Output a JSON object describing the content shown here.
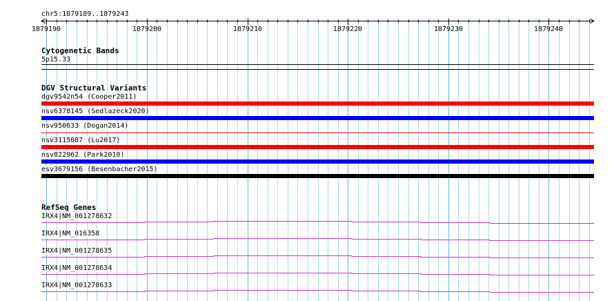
{
  "locus": "chr5:1879189..1879243",
  "ruler": {
    "start": 1879189.5,
    "end": 1879244.5,
    "ticks": [
      {
        "pos": 1879190,
        "label": "1879190"
      },
      {
        "pos": 1879200,
        "label": "1879200"
      },
      {
        "pos": 1879210,
        "label": "1879210"
      },
      {
        "pos": 1879220,
        "label": "1879220"
      },
      {
        "pos": 1879230,
        "label": "1879230"
      },
      {
        "pos": 1879240,
        "label": "1879240"
      }
    ]
  },
  "colors": {
    "grid_minor": "#a8d8e8",
    "grid_major": "#6fb6cf",
    "dgv_loss": "#ff0000",
    "dgv_gain": "#0000ff",
    "dgv_complex": "#000000",
    "refseq": "#cc33cc"
  },
  "tracks": {
    "cytoband": {
      "title": "Cytogenetic Bands",
      "band": "5p15.33"
    },
    "dgv": {
      "title": "DGV Structural Variants",
      "items": [
        {
          "label": "dgv9542n54 (Cooper2011)",
          "color": "#ff0000",
          "style": "thick"
        },
        {
          "label": "nsv6378145 (Sedlazeck2020)",
          "color": "#0000ff",
          "style": "thick"
        },
        {
          "label": "nsv950633 (Dogan2014)",
          "color": "#ff0000",
          "style": "thin"
        },
        {
          "label": "nsv3115087 (Lu2017)",
          "color": "#ff0000",
          "style": "thick"
        },
        {
          "label": "nsv822962 (Park2010)",
          "color": "#0000ff",
          "style": "thick"
        },
        {
          "label": "esv3679156 (Besenbacher2015)",
          "color": "#000000",
          "style": "thick"
        }
      ]
    },
    "refseq": {
      "title": "RefSeq Genes",
      "items": [
        {
          "label": "IRX4|NM_001278632"
        },
        {
          "label": "IRX4|NM_016358"
        },
        {
          "label": "IRX4|NM_001278635"
        },
        {
          "label": "IRX4|NM_001278634"
        },
        {
          "label": "IRX4|NM_001278633"
        }
      ]
    }
  }
}
